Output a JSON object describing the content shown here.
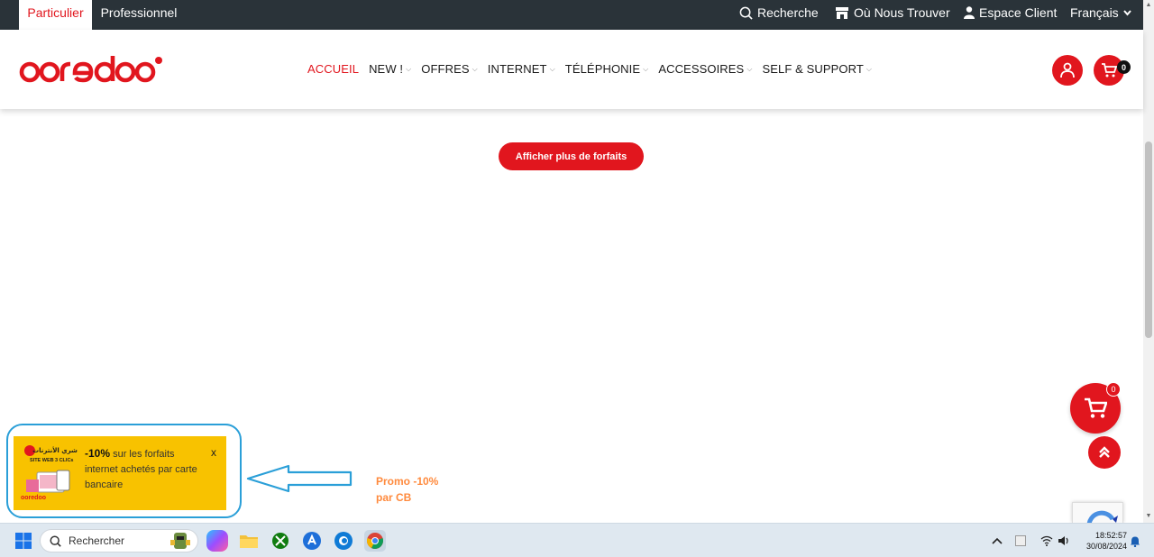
{
  "topbar": {
    "tabs": [
      {
        "label": "Particulier",
        "active": true
      },
      {
        "label": "Professionnel",
        "active": false
      }
    ],
    "links": {
      "search": "Recherche",
      "stores": "Où Nous Trouver",
      "account": "Espace Client",
      "language": "Français"
    }
  },
  "header": {
    "logo_text": "ooredoo",
    "nav": [
      {
        "label": "ACCUEIL",
        "active": true,
        "dropdown": false
      },
      {
        "label": "NEW !",
        "active": false,
        "dropdown": true
      },
      {
        "label": "OFFRES",
        "active": false,
        "dropdown": true
      },
      {
        "label": "INTERNET",
        "active": false,
        "dropdown": true
      },
      {
        "label": "TÉLÉPHONIE",
        "active": false,
        "dropdown": true
      },
      {
        "label": "ACCESSOIRES",
        "active": false,
        "dropdown": true
      },
      {
        "label": "SELF & SUPPORT",
        "active": false,
        "dropdown": true
      }
    ],
    "cart_count": "0"
  },
  "main": {
    "more_button": "Afficher plus de forfaits",
    "floating_cart_count": "0"
  },
  "promo": {
    "percent": "-10%",
    "text": " sur les forfaits internet achetés par carte bancaire",
    "close": "x",
    "image_title_ar": "شري الأنترنات",
    "image_subtitle": "SITE WEB",
    "image_clic": "3 CLICs",
    "image_logo": "ooredoo"
  },
  "annotation": {
    "line1": "Promo -10%",
    "line2": "par CB"
  },
  "taskbar": {
    "search_placeholder": "Rechercher",
    "time": "18:52:57",
    "date": "30/08/2024"
  },
  "colors": {
    "brand_red": "#e1161e",
    "topbar_bg": "#2a3339",
    "promo_bg": "#f8c200",
    "annotation_blue": "#2a9fd8",
    "annotation_orange": "#ff8a3d"
  }
}
